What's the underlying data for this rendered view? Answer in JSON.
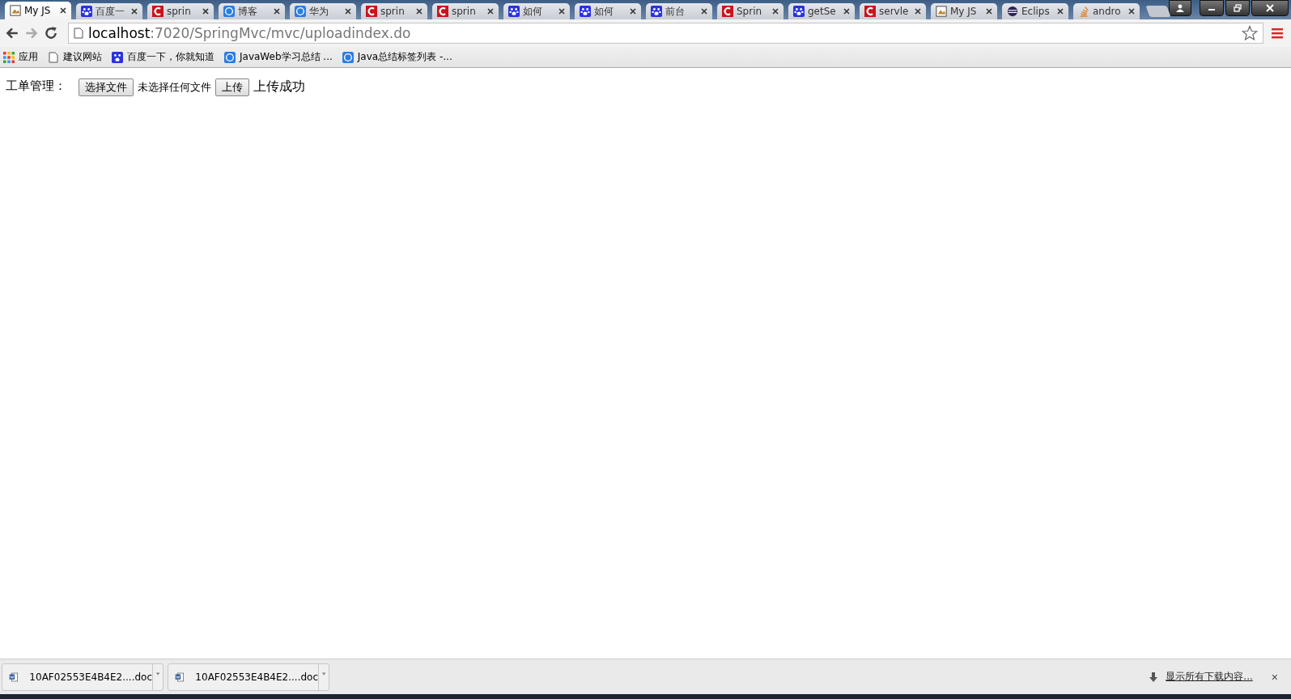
{
  "tabs": [
    {
      "title": "My JS",
      "kind": "page",
      "selected": true
    },
    {
      "title": "百度一",
      "kind": "paw",
      "selected": false
    },
    {
      "title": "sprin",
      "kind": "c",
      "selected": false
    },
    {
      "title": "博客",
      "kind": "ring",
      "selected": false
    },
    {
      "title": "华为",
      "kind": "ring",
      "selected": false
    },
    {
      "title": "sprin",
      "kind": "c",
      "selected": false
    },
    {
      "title": "sprin",
      "kind": "c",
      "selected": false
    },
    {
      "title": "如何",
      "kind": "paw",
      "selected": false
    },
    {
      "title": "如何",
      "kind": "paw",
      "selected": false
    },
    {
      "title": "前台",
      "kind": "paw",
      "selected": false
    },
    {
      "title": "Sprin",
      "kind": "c",
      "selected": false
    },
    {
      "title": "getSe",
      "kind": "paw",
      "selected": false
    },
    {
      "title": "servle",
      "kind": "c",
      "selected": false
    },
    {
      "title": "My JS",
      "kind": "page",
      "selected": false
    },
    {
      "title": "Eclips",
      "kind": "eclipse",
      "selected": false
    },
    {
      "title": "andro",
      "kind": "stack",
      "selected": false
    }
  ],
  "address": {
    "host": "localhost",
    "rest": ":7020/SpringMvc/mvc/uploadindex.do"
  },
  "bookmarks": [
    {
      "label": "应用",
      "kind": "apps"
    },
    {
      "label": "建议网站",
      "kind": "page"
    },
    {
      "label": "百度一下，你就知道",
      "kind": "paw"
    },
    {
      "label": "JavaWeb学习总结 ...",
      "kind": "ring"
    },
    {
      "label": "Java总结标签列表 -...",
      "kind": "ring"
    }
  ],
  "page": {
    "label": "工单管理：",
    "choose_button": "选择文件",
    "no_file": "未选择任何文件",
    "upload_button": "上传",
    "result": "上传成功"
  },
  "downloads": [
    {
      "name": "10AF02553E4B4E2....doc"
    },
    {
      "name": "10AF02553E4B4E2....doc"
    }
  ],
  "show_all": "显示所有下载内容...",
  "close": "×"
}
